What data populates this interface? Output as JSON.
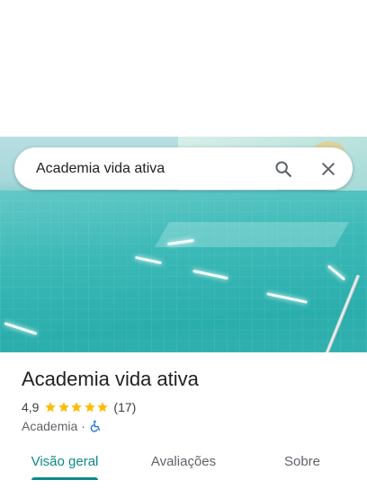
{
  "search": {
    "query": "Academia vida ativa"
  },
  "place": {
    "name": "Academia vida ativa",
    "rating": "4,9",
    "stars": 5,
    "review_count": "(17)",
    "category": "Academia",
    "separator": "·"
  },
  "tabs": [
    {
      "label": "Visão geral",
      "active": true
    },
    {
      "label": "Avaliações",
      "active": false
    },
    {
      "label": "Sobre",
      "active": false
    }
  ],
  "colors": {
    "accent": "#0b8a88",
    "star": "#fbbc04",
    "accessibility": "#1a73e8"
  },
  "icons": {
    "search": "search-icon",
    "close": "close-icon",
    "accessibility": "wheelchair-icon"
  }
}
